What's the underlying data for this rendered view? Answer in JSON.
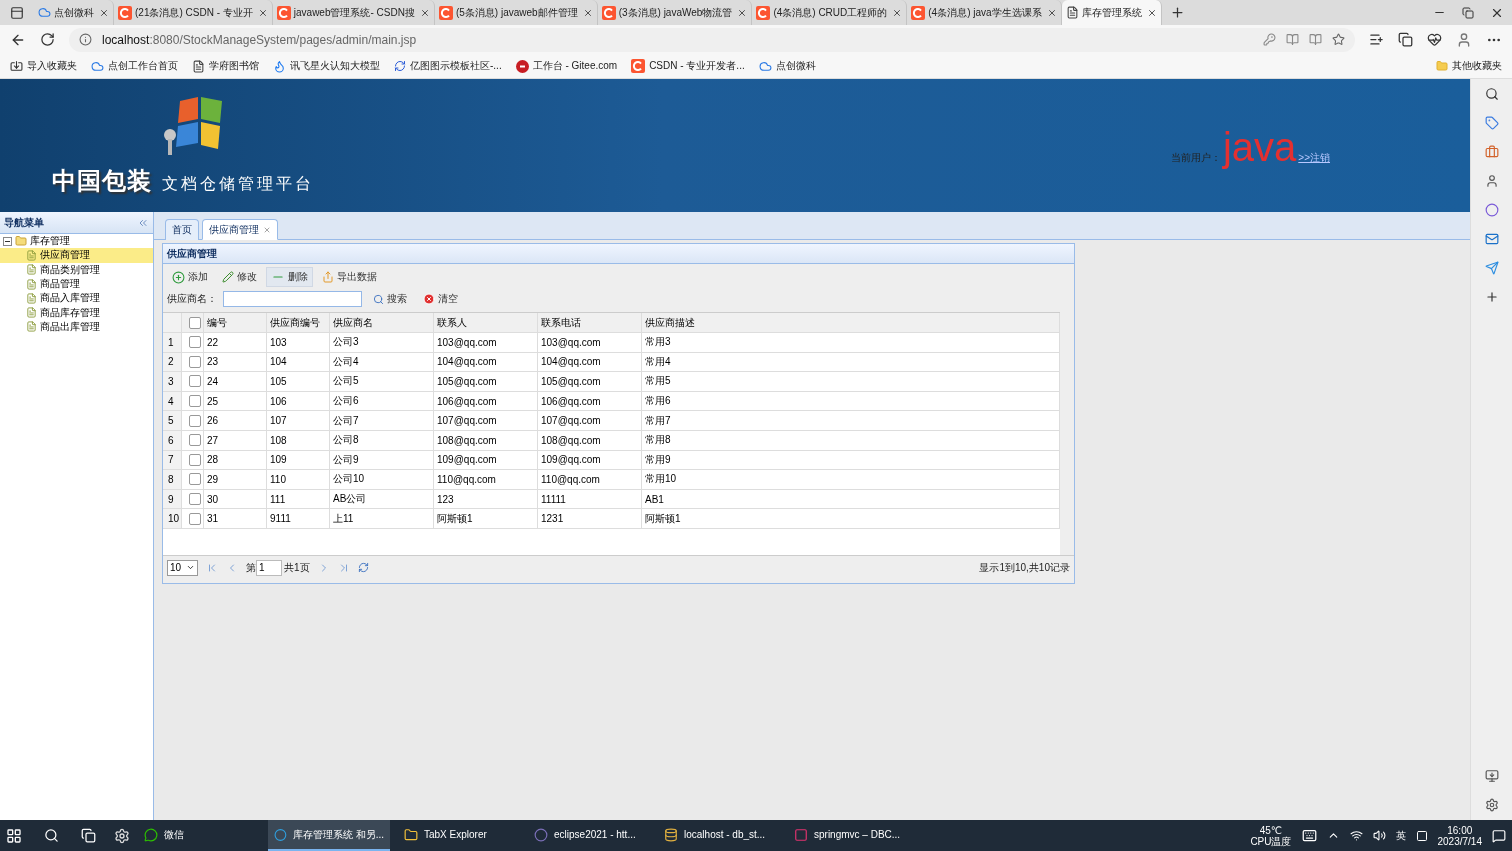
{
  "browser": {
    "tabs": [
      {
        "title": "点创微科",
        "selected": false
      },
      {
        "title": "(21条消息) CSDN - 专业开",
        "selected": false
      },
      {
        "title": "javaweb管理系统- CSDN搜",
        "selected": false
      },
      {
        "title": "(5条消息) javaweb邮件管理",
        "selected": false
      },
      {
        "title": "(3条消息) javaWeb物流管",
        "selected": false
      },
      {
        "title": "(4条消息) CRUD工程师的",
        "selected": false
      },
      {
        "title": "(4条消息) java学生选课系",
        "selected": false
      },
      {
        "title": "库存管理系统",
        "selected": true
      }
    ],
    "address_host": "localhost",
    "address_rest": ":8080/StockManageSystem/pages/admin/main.jsp",
    "bookmarks": [
      "导入收藏夹",
      "点创工作台首页",
      "学府图书馆",
      "讯飞星火认知大模型",
      "亿图图示模板社区-...",
      "工作台 - Gitee.com",
      "CSDN - 专业开发者...",
      "点创微科"
    ],
    "other_bookmarks": "其他收藏夹"
  },
  "header": {
    "brand": "中国包装",
    "subtitle": "文档仓储管理平台",
    "user_label": "当前用户：",
    "user": "java",
    "logout": ">>注销"
  },
  "nav": {
    "title": "导航菜单",
    "tree": [
      {
        "label": "库存管理",
        "expanded": true,
        "children": [
          {
            "label": "供应商管理",
            "selected": true
          },
          {
            "label": "商品类别管理",
            "selected": false
          },
          {
            "label": "商品管理",
            "selected": false
          },
          {
            "label": "商品入库管理",
            "selected": false
          },
          {
            "label": "商品库存管理",
            "selected": false
          },
          {
            "label": "商品出库管理",
            "selected": false
          }
        ]
      }
    ]
  },
  "tabs": [
    {
      "label": "首页",
      "selected": false,
      "closable": false
    },
    {
      "label": "供应商管理",
      "selected": true,
      "closable": true
    }
  ],
  "panel": {
    "title": "供应商管理",
    "toolbar": [
      {
        "kind": "add",
        "label": "添加",
        "hovered": false
      },
      {
        "kind": "edit",
        "label": "修改",
        "hovered": false
      },
      {
        "kind": "delete",
        "label": "删除",
        "hovered": true
      },
      {
        "kind": "export",
        "label": "导出数据",
        "hovered": false
      }
    ],
    "search": {
      "label": "供应商名：",
      "button": "搜索",
      "clear": "清空"
    },
    "all_checked": false,
    "columns": [
      "编号",
      "供应商编号",
      "供应商名",
      "联系人",
      "联系电话",
      "供应商描述"
    ],
    "rows": [
      {
        "num": "1",
        "checked": false,
        "cells": [
          "22",
          "103",
          "公司3",
          "103@qq.com",
          "103@qq.com",
          "常用3"
        ]
      },
      {
        "num": "2",
        "checked": false,
        "cells": [
          "23",
          "104",
          "公司4",
          "104@qq.com",
          "104@qq.com",
          "常用4"
        ]
      },
      {
        "num": "3",
        "checked": false,
        "cells": [
          "24",
          "105",
          "公司5",
          "105@qq.com",
          "105@qq.com",
          "常用5"
        ]
      },
      {
        "num": "4",
        "checked": false,
        "cells": [
          "25",
          "106",
          "公司6",
          "106@qq.com",
          "106@qq.com",
          "常用6"
        ]
      },
      {
        "num": "5",
        "checked": false,
        "cells": [
          "26",
          "107",
          "公司7",
          "107@qq.com",
          "107@qq.com",
          "常用7"
        ]
      },
      {
        "num": "6",
        "checked": false,
        "cells": [
          "27",
          "108",
          "公司8",
          "108@qq.com",
          "108@qq.com",
          "常用8"
        ]
      },
      {
        "num": "7",
        "checked": false,
        "cells": [
          "28",
          "109",
          "公司9",
          "109@qq.com",
          "109@qq.com",
          "常用9"
        ]
      },
      {
        "num": "8",
        "checked": false,
        "cells": [
          "29",
          "110",
          "公司10",
          "110@qq.com",
          "110@qq.com",
          "常用10"
        ]
      },
      {
        "num": "9",
        "checked": false,
        "cells": [
          "30",
          "111",
          "AB公司",
          "123",
          "11111",
          "AB1"
        ]
      },
      {
        "num": "10",
        "checked": false,
        "cells": [
          "31",
          "9111",
          "上11",
          "阿斯顿1",
          "1231",
          "阿斯顿1"
        ]
      }
    ],
    "pager": {
      "page_size": "10",
      "page_label": "第",
      "page": "1",
      "total_pages": "共1页",
      "summary": "显示1到10,共10记录"
    }
  },
  "taskbar": {
    "items": [
      {
        "label": "微信",
        "selected": false
      },
      {
        "label": "库存管理系统 和另...",
        "selected": true
      },
      {
        "label": "TabX Explorer",
        "selected": false
      },
      {
        "label": "eclipse2021 - htt...",
        "selected": false
      },
      {
        "label": "localhost - db_st...",
        "selected": false
      },
      {
        "label": "springmvc – DBC...",
        "selected": false
      }
    ],
    "temperature": "45℃",
    "temperature_label": "CPU温度",
    "ime": "英",
    "time": "16:00",
    "date": "2023/7/14"
  }
}
